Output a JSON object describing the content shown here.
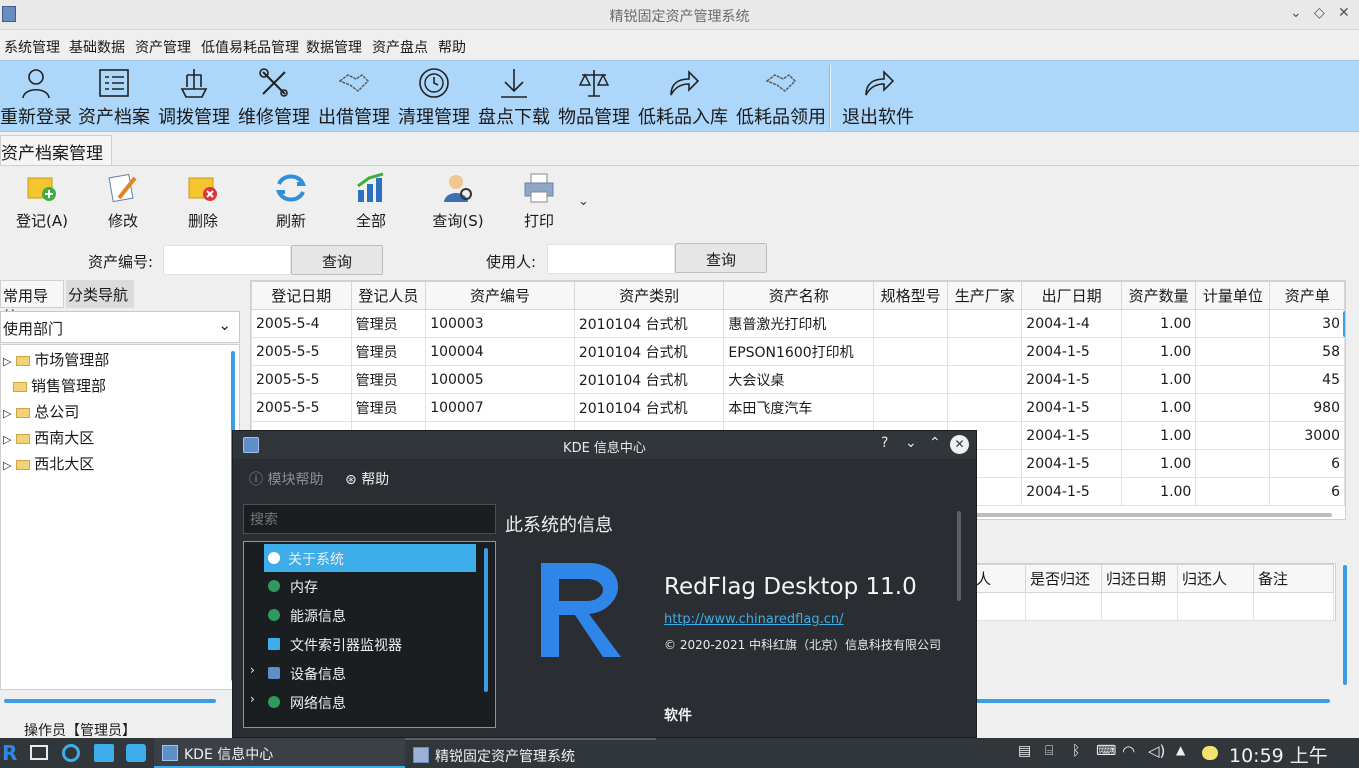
{
  "window": {
    "title": "精锐固定资产管理系统"
  },
  "menu": [
    "系统管理",
    "基础数据",
    "资产管理",
    "低值易耗品管理",
    "数据管理",
    "资产盘点",
    "帮助"
  ],
  "bigbar": [
    {
      "label": "重新登录",
      "icon": "person-icon"
    },
    {
      "label": "资产档案",
      "icon": "archive-icon"
    },
    {
      "label": "调拨管理",
      "icon": "ship-icon"
    },
    {
      "label": "维修管理",
      "icon": "tools-icon"
    },
    {
      "label": "出借管理",
      "icon": "handshake-icon"
    },
    {
      "label": "清理管理",
      "icon": "clock-icon"
    },
    {
      "label": "盘点下载",
      "icon": "download-icon"
    },
    {
      "label": "物品管理",
      "icon": "scale-icon"
    },
    {
      "label": "低耗品入库",
      "icon": "forward-arrow-icon"
    },
    {
      "label": "低耗品领用",
      "icon": "handshake-icon"
    },
    {
      "label": "退出软件",
      "icon": "exit-arrow-icon"
    }
  ],
  "doc_tab": "资产档案管理",
  "smallbar": [
    {
      "label": "登记(A)",
      "icon": "folder-add-icon"
    },
    {
      "label": "修改",
      "icon": "edit-icon"
    },
    {
      "label": "删除",
      "icon": "folder-delete-icon"
    },
    {
      "label": "刷新",
      "icon": "refresh-icon"
    },
    {
      "label": "全部",
      "icon": "chart-icon"
    },
    {
      "label": "查询(S)",
      "icon": "user-search-icon"
    },
    {
      "label": "打印",
      "icon": "printer-icon"
    }
  ],
  "search": {
    "asset_no_label": "资产编号:",
    "query_label": "查询",
    "user_label": "使用人:",
    "asset_no_value": "",
    "user_value": ""
  },
  "nav": {
    "tabs": [
      "常用导航",
      "分类导航"
    ],
    "select": "使用部门",
    "tree": [
      "市场管理部",
      "销售管理部",
      "总公司",
      "西南大区",
      "西北大区"
    ]
  },
  "grid": {
    "columns": [
      "登记日期",
      "登记人员",
      "资产编号",
      "资产类别",
      "资产名称",
      "规格型号",
      "生产厂家",
      "出厂日期",
      "资产数量",
      "计量单位",
      "资产单"
    ],
    "rows": [
      [
        "2005-5-4",
        "管理员",
        "100003",
        "2010104 台式机",
        "惠普激光打印机",
        "",
        "",
        "2004-1-4",
        "1.00",
        "",
        "30"
      ],
      [
        "2005-5-5",
        "管理员",
        "100004",
        "2010104 台式机",
        "EPSON1600打印机",
        "",
        "",
        "2004-1-5",
        "1.00",
        "",
        "58"
      ],
      [
        "2005-5-5",
        "管理员",
        "100005",
        "2010104 台式机",
        "大会议桌",
        "",
        "",
        "2004-1-5",
        "1.00",
        "",
        "45"
      ],
      [
        "2005-5-5",
        "管理员",
        "100007",
        "2010104 台式机",
        "本田飞度汽车",
        "",
        "",
        "2004-1-5",
        "1.00",
        "",
        "980"
      ],
      [
        "",
        "",
        "",
        "",
        "",
        "",
        "",
        "2004-1-5",
        "1.00",
        "",
        "3000"
      ],
      [
        "",
        "",
        "",
        "",
        "",
        "",
        "",
        "2004-1-5",
        "1.00",
        "",
        "6"
      ],
      [
        "",
        "",
        "",
        "",
        "",
        "",
        "",
        "2004-1-5",
        "1.00",
        "",
        "6"
      ]
    ]
  },
  "grid2": {
    "columns": [
      "人",
      "是否归还",
      "归还日期",
      "归还人",
      "备注"
    ]
  },
  "status": "操作员【管理员】",
  "kde": {
    "title": "KDE 信息中心",
    "module_help": "模块帮助",
    "help": "帮助",
    "search_placeholder": "搜索",
    "items": [
      "关于系统",
      "内存",
      "能源信息",
      "文件索引器监视器",
      "设备信息",
      "网络信息"
    ],
    "heading": "此系统的信息",
    "product": "RedFlag Desktop 11.0",
    "url": "http://www.chinaredflag.cn/",
    "copyright": "© 2020-2021 中科红旗（北京）信息科技有限公司",
    "software": "软件"
  },
  "taskbar": {
    "tasks": [
      "KDE 信息中心",
      "精锐固定资产管理系统"
    ],
    "clock": "10:59 上午"
  }
}
